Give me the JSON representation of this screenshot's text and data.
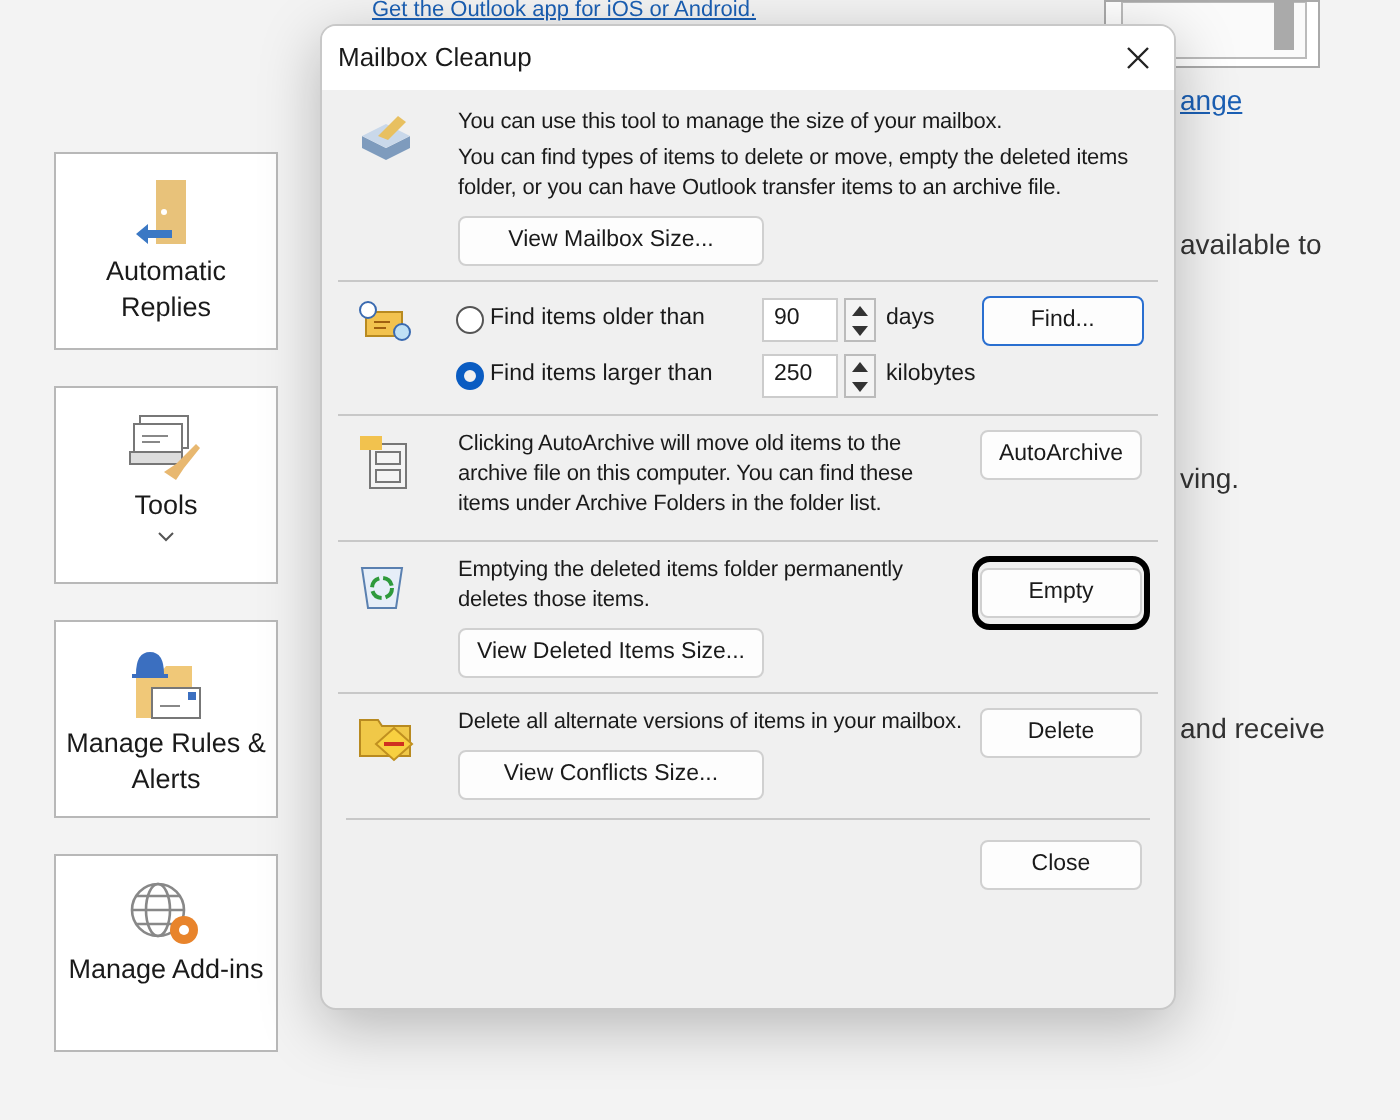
{
  "background": {
    "link": "Get the Outlook app for iOS or Android.",
    "tiles": [
      {
        "kind": "replies",
        "label": "Automatic Replies",
        "dropdown": false
      },
      {
        "kind": "tools",
        "label": "Tools",
        "dropdown": true
      },
      {
        "kind": "rules",
        "label": "Manage Rules & Alerts",
        "dropdown": false
      },
      {
        "kind": "addins",
        "label": "Manage Add-ins",
        "dropdown": false
      }
    ],
    "side_texts": [
      {
        "kind": "link",
        "text": "ange"
      },
      {
        "kind": "text",
        "text": "available to"
      },
      {
        "kind": "text",
        "text": "ving."
      },
      {
        "kind": "text",
        "text": "and receive"
      }
    ]
  },
  "dialog": {
    "title": "Mailbox Cleanup",
    "sections": [
      {
        "kind": "info",
        "lines": [
          "You can use this tool to manage the size of your mailbox.",
          "You can find types of items to delete or move, empty the deleted items folder, or you can have Outlook transfer items to an archive file."
        ],
        "sub_button": "View Mailbox Size..."
      },
      {
        "kind": "find",
        "options": [
          {
            "label": "Find items older than",
            "selected": false,
            "value": "90",
            "unit": "days"
          },
          {
            "label": "Find items larger than",
            "selected": true,
            "value": "250",
            "unit": "kilobytes"
          }
        ],
        "button": {
          "label": "Find...",
          "focused": true,
          "circled": false
        }
      },
      {
        "kind": "action",
        "lines": [
          "Clicking AutoArchive will move old items to the archive file on this computer. You can find these items under Archive Folders in the folder list."
        ],
        "button": {
          "label": "AutoArchive",
          "focused": false,
          "circled": false
        }
      },
      {
        "kind": "action",
        "lines": [
          "Emptying the deleted items folder permanently deletes those items."
        ],
        "button": {
          "label": "Empty",
          "focused": false,
          "circled": true
        },
        "sub_button": "View Deleted Items Size..."
      },
      {
        "kind": "action",
        "lines": [
          "Delete all alternate versions of items in your mailbox."
        ],
        "button": {
          "label": "Delete",
          "focused": false,
          "circled": false
        },
        "sub_button": "View Conflicts Size..."
      }
    ],
    "close_button": "Close"
  }
}
